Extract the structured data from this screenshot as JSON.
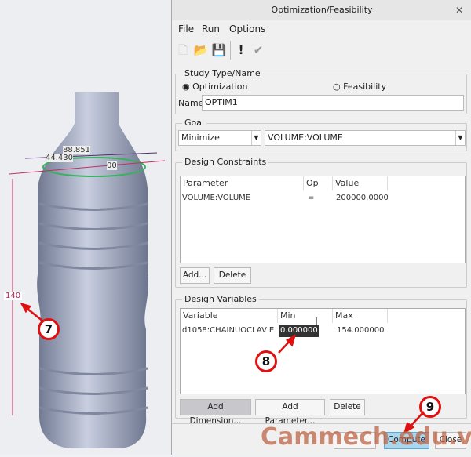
{
  "viewport": {
    "dimensions": {
      "height": "140",
      "diameter1": "44.430",
      "diameter2": "88.851",
      "angle": "00"
    }
  },
  "dialog": {
    "title": "Optimization/Feasibility",
    "menu": [
      "File",
      "Run",
      "Options"
    ],
    "toolbar": [
      "new-icon",
      "open-icon",
      "save-icon",
      "exclamation-icon",
      "check-icon"
    ],
    "study": {
      "label": "Study Type/Name",
      "optimization": "Optimization",
      "feasibility": "Feasibility",
      "selected": "Optimization",
      "name_label": "Name",
      "name_value": "OPTIM1"
    },
    "goal": {
      "label": "Goal",
      "mode": "Minimize",
      "target": "VOLUME:VOLUME"
    },
    "constraints": {
      "label": "Design Constraints",
      "headers": [
        "Parameter",
        "Op",
        "Value"
      ],
      "rows": [
        [
          "VOLUME:VOLUME",
          "=",
          "200000.000000"
        ]
      ],
      "add": "Add...",
      "delete": "Delete"
    },
    "variables": {
      "label": "Design Variables",
      "headers": [
        "Variable",
        "Min",
        "Max"
      ],
      "rows": [
        [
          "d1058:CHAINUOCLAVIE",
          "0.000000",
          "154.000000"
        ]
      ],
      "add_dimension": "Add Dimension...",
      "add_parameter": "Add Parameter...",
      "delete": "Delete"
    },
    "footer": {
      "compute": "Compute",
      "close": "Close"
    }
  },
  "annotations": {
    "m7": "7",
    "m8": "8",
    "m9": "9",
    "watermark": "Cammech.edu.vn"
  },
  "colors": {
    "marker": "#e01010",
    "selection": "#333333",
    "compute_highlight": "#a8d8f0"
  }
}
